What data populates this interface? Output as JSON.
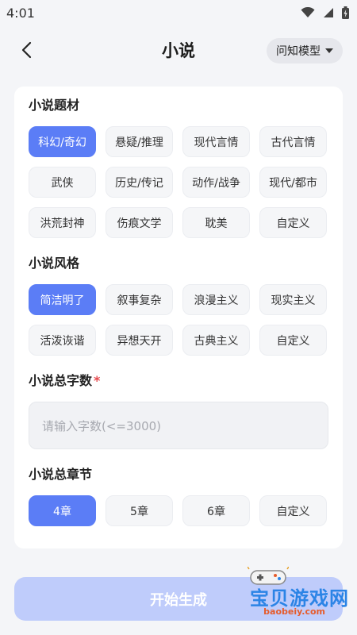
{
  "status_bar": {
    "time": "4:01"
  },
  "header": {
    "title": "小说",
    "model_selector": "问知模型"
  },
  "sections": {
    "genre": {
      "title": "小说题材",
      "options": [
        "科幻/奇幻",
        "悬疑/推理",
        "现代言情",
        "古代言情",
        "武侠",
        "历史/传记",
        "动作/战争",
        "现代/都市",
        "洪荒封神",
        "伤痕文学",
        "耽美",
        "自定义"
      ],
      "selected": "科幻/奇幻"
    },
    "style": {
      "title": "小说风格",
      "options": [
        "简洁明了",
        "叙事复杂",
        "浪漫主义",
        "现实主义",
        "活泼诙谐",
        "异想天开",
        "古典主义",
        "自定义"
      ],
      "selected": "简洁明了"
    },
    "word_count": {
      "title": "小说总字数",
      "required_mark": "*",
      "placeholder": "请输入字数(<=3000)",
      "value": ""
    },
    "chapters": {
      "title": "小说总章节",
      "options": [
        "4章",
        "5章",
        "6章",
        "自定义"
      ],
      "selected": "4章"
    }
  },
  "footer": {
    "generate_label": "开始生成"
  },
  "watermark": {
    "brand": "宝贝游戏网",
    "url": "baobeiy.com"
  },
  "colors": {
    "accent": "#5b7df6",
    "button_disabled": "#bfccfb",
    "required": "#e5484d",
    "background": "#f4f5f8"
  },
  "icons": [
    "back-arrow-icon",
    "wifi-icon",
    "signal-icon",
    "battery-icon",
    "dropdown-caret-icon",
    "gamepad-icon"
  ]
}
